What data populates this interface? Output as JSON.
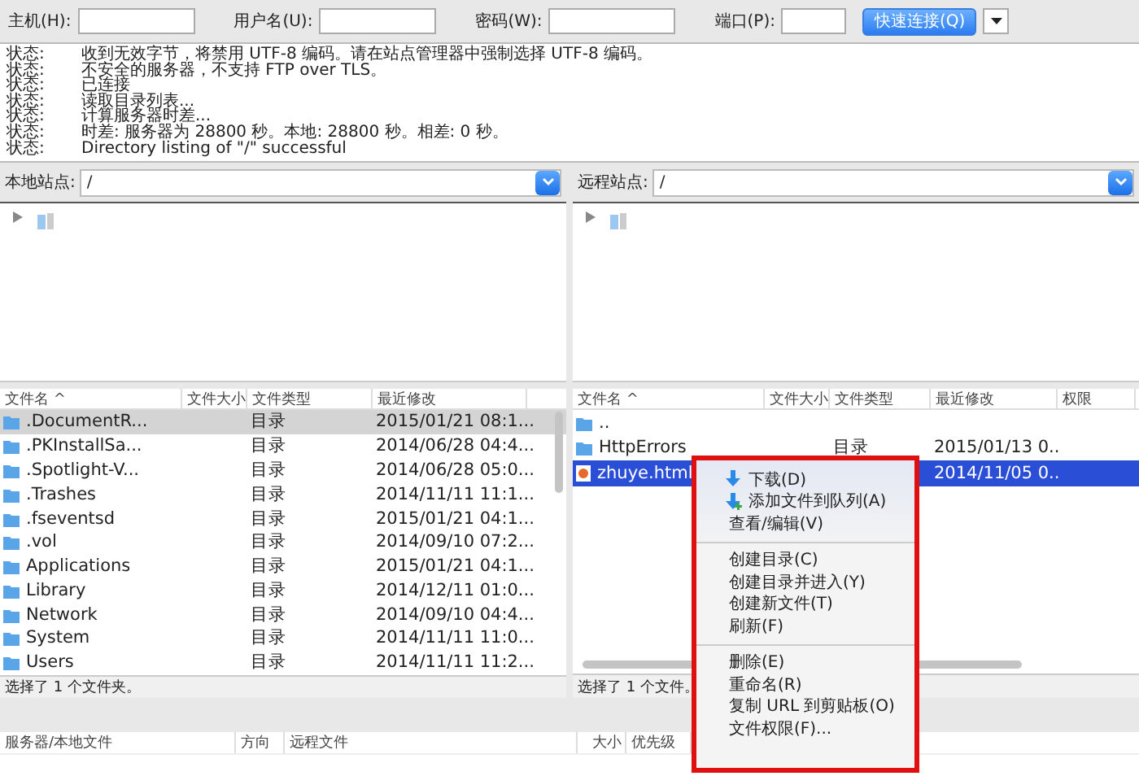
{
  "quickconnect": {
    "fields": [
      {
        "label": "主机(H):"
      },
      {
        "label": "用户名(U):"
      },
      {
        "label": "密码(W):"
      },
      {
        "label": "端口(P):"
      }
    ],
    "button": "快速连接(Q)"
  },
  "log": [
    {
      "label": "状态:",
      "text": "收到无效字节，将禁用 UTF-8 编码。请在站点管理器中强制选择 UTF-8 编码。"
    },
    {
      "label": "状态:",
      "text": "不安全的服务器，不支持 FTP over TLS。"
    },
    {
      "label": "状态:",
      "text": "已连接"
    },
    {
      "label": "状态:",
      "text": "读取目录列表..."
    },
    {
      "label": "状态:",
      "text": "计算服务器时差..."
    },
    {
      "label": "状态:",
      "text": "时差: 服务器为 28800 秒。本地: 28800 秒。相差: 0 秒。"
    },
    {
      "label": "状态:",
      "text": "Directory listing of \"/\" successful"
    }
  ],
  "local": {
    "site_label": "本地站点:",
    "path": "/",
    "columns": [
      "文件名 ^",
      "文件大小",
      "文件类型",
      "最近修改"
    ],
    "rows": [
      {
        "name": ".DocumentR...",
        "type": "目录",
        "modified": "2015/01/21 08:1...",
        "selected": true
      },
      {
        "name": ".PKInstallSa...",
        "type": "目录",
        "modified": "2014/06/28 04:4...",
        "selected": false
      },
      {
        "name": ".Spotlight-V...",
        "type": "目录",
        "modified": "2014/06/28 05:0...",
        "selected": false
      },
      {
        "name": ".Trashes",
        "type": "目录",
        "modified": "2014/11/11 11:1...",
        "selected": false
      },
      {
        "name": ".fseventsd",
        "type": "目录",
        "modified": "2015/01/21 04:1...",
        "selected": false
      },
      {
        "name": ".vol",
        "type": "目录",
        "modified": "2014/09/10 07:2...",
        "selected": false
      },
      {
        "name": "Applications",
        "type": "目录",
        "modified": "2015/01/21 04:1...",
        "selected": false
      },
      {
        "name": "Library",
        "type": "目录",
        "modified": "2014/12/11 01:0...",
        "selected": false
      },
      {
        "name": "Network",
        "type": "目录",
        "modified": "2014/09/10 04:4...",
        "selected": false
      },
      {
        "name": "System",
        "type": "目录",
        "modified": "2014/11/11 11:0...",
        "selected": false
      },
      {
        "name": "Users",
        "type": "目录",
        "modified": "2014/11/11 11:2...",
        "selected": false
      }
    ],
    "status": "选择了 1 个文件夹。"
  },
  "remote": {
    "site_label": "远程站点:",
    "path": "/",
    "columns": [
      "文件名 ^",
      "文件大小",
      "文件类型",
      "最近修改",
      "权限"
    ],
    "rows": [
      {
        "kind": "folder",
        "name": "..",
        "selected": false
      },
      {
        "kind": "folder",
        "name": "HttpErrors",
        "type": "目录",
        "modified": "2015/01/13 0..",
        "selected": false
      },
      {
        "kind": "file",
        "name": "zhuye.html",
        "modified": "2014/11/05 0..",
        "selected": true
      }
    ],
    "status": "选择了 1 个文件。"
  },
  "queue": {
    "columns": [
      "服务器/本地文件",
      "方向",
      "远程文件",
      "大小",
      "优先级"
    ]
  },
  "context_menu": [
    {
      "kind": "download",
      "label": "下载(D)"
    },
    {
      "kind": "enqueue",
      "label": "添加文件到队列(A)"
    },
    {
      "kind": "item",
      "label": "查看/编辑(V)"
    },
    {
      "kind": "separator"
    },
    {
      "kind": "item",
      "label": "创建目录(C)"
    },
    {
      "kind": "item",
      "label": "创建目录并进入(Y)"
    },
    {
      "kind": "item",
      "label": "创建新文件(T)"
    },
    {
      "kind": "item",
      "label": "刷新(F)"
    },
    {
      "kind": "separator"
    },
    {
      "kind": "item",
      "label": "删除(E)"
    },
    {
      "kind": "item",
      "label": "重命名(R)"
    },
    {
      "kind": "item",
      "label": "复制 URL 到剪贴板(O)"
    },
    {
      "kind": "item",
      "label": "文件权限(F)..."
    }
  ]
}
